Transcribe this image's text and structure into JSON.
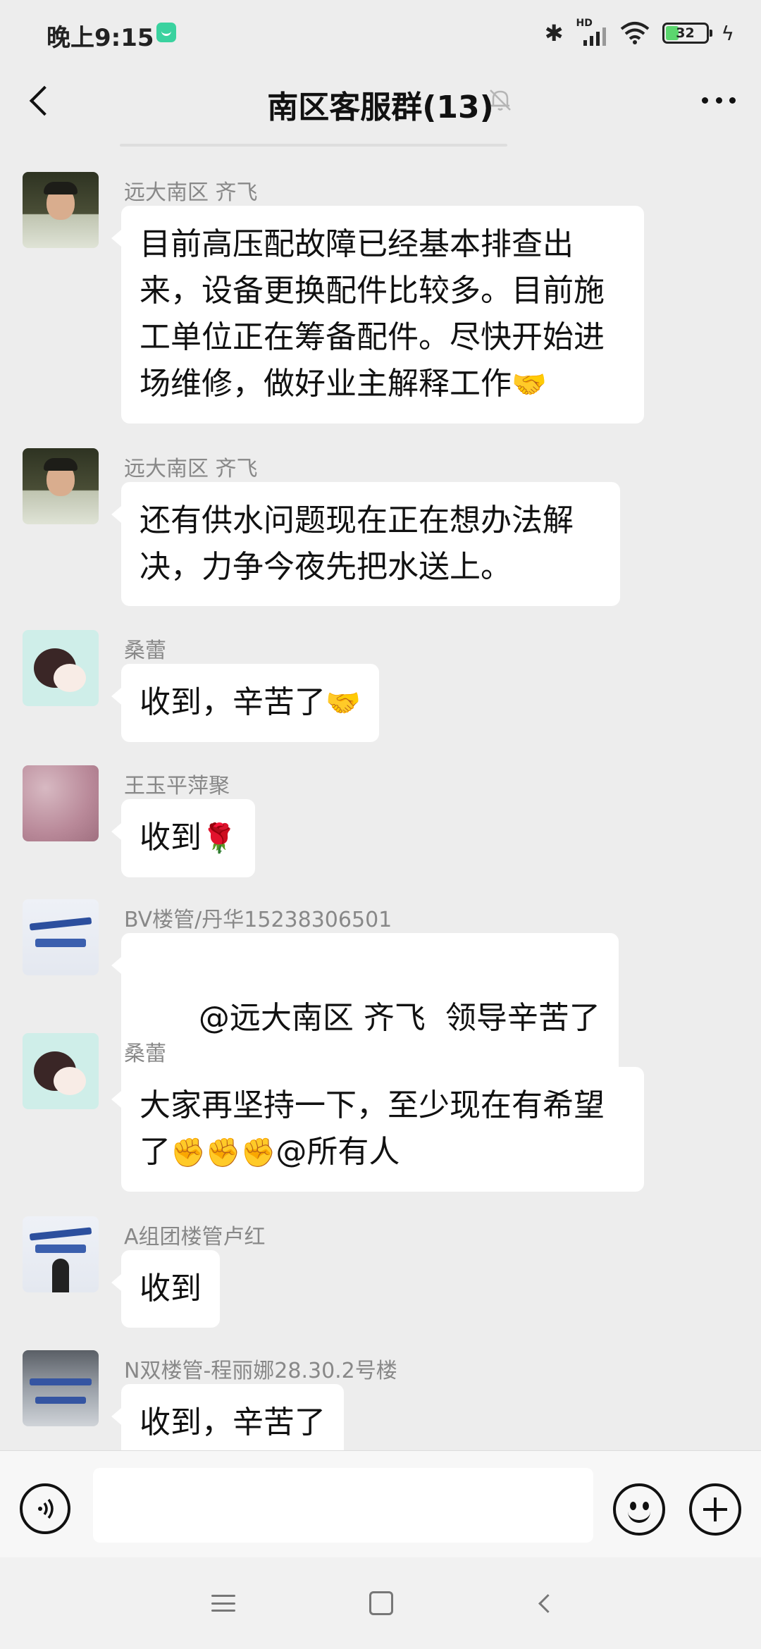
{
  "status_bar": {
    "time": "晚上9:15",
    "network_badge": "HD",
    "battery_level": "32",
    "battery_fraction": 0.32
  },
  "header": {
    "title": "南区客服群(13)",
    "muted": true
  },
  "messages": [
    {
      "sender": "远大南区 齐飞",
      "avatar": "man-photo",
      "text": "目前高压配故障已经基本排查出来，设备更换配件比较多。目前施工单位正在筹备配件。尽快开始进场维修，做好业主解释工作",
      "emoji": "🤝"
    },
    {
      "sender": "远大南区 齐飞",
      "avatar": "man-photo",
      "text": "还有供水问题现在正在想办法解决，力争今夜先把水送上。",
      "emoji": ""
    },
    {
      "sender": "桑蕾",
      "avatar": "girl-illustration",
      "text": "收到，辛苦了",
      "emoji": "🤝"
    },
    {
      "sender": "王玉平萍聚",
      "avatar": "pink-texture",
      "text": "收到",
      "emoji": "🌹"
    },
    {
      "sender": "BV楼管/丹华15238306501",
      "avatar": "service-center-sign",
      "text": "@远大南区 齐飞  领导辛苦了",
      "emoji": ""
    },
    {
      "sender": "桑蕾",
      "avatar": "girl-illustration",
      "text": "大家再坚持一下，至少现在有希望了",
      "emoji": "✊✊✊",
      "suffix": "@所有人"
    },
    {
      "sender": "A组团楼管卢红",
      "avatar": "service-center-person",
      "text": "收到",
      "emoji": ""
    },
    {
      "sender": "N双楼管-程丽娜28.30.2号楼",
      "avatar": "service-center-sign-dark",
      "text": "收到，辛苦了",
      "emoji": ""
    }
  ],
  "input_bar": {
    "voice_icon": "voice-icon",
    "emoji_icon": "emoji-icon",
    "plus_icon": "plus-icon",
    "placeholder": ""
  },
  "nav_bar": {
    "icons": [
      "menu-icon",
      "home-icon",
      "back-icon"
    ]
  }
}
